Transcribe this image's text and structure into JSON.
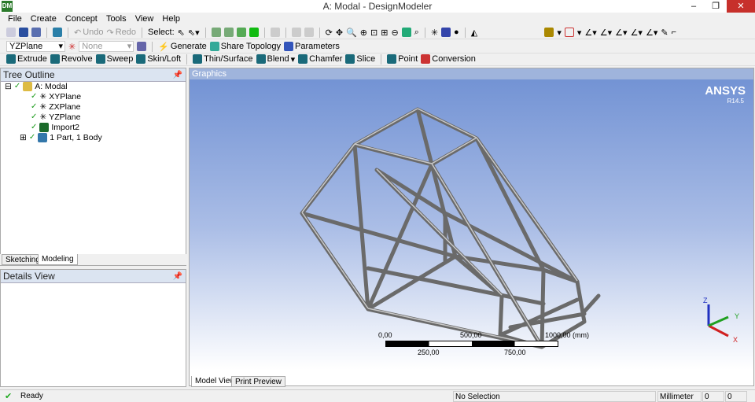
{
  "window": {
    "title": "A: Modal - DesignModeler",
    "app_icon": "DM",
    "minimize": "–",
    "restore": "❐",
    "close": "✕"
  },
  "menu": [
    "File",
    "Create",
    "Concept",
    "Tools",
    "View",
    "Help"
  ],
  "toolbar1": {
    "undo": "Undo",
    "redo": "Redo",
    "select": "Select:"
  },
  "toolbar2": {
    "plane": "YZPlane",
    "sketch": "None",
    "generate": "Generate",
    "share_topology": "Share Topology",
    "parameters": "Parameters"
  },
  "toolbar3": {
    "extrude": "Extrude",
    "revolve": "Revolve",
    "sweep": "Sweep",
    "skin_loft": "Skin/Loft",
    "thin_surface": "Thin/Surface",
    "blend": "Blend",
    "chamfer": "Chamfer",
    "slice": "Slice",
    "point": "Point",
    "conversion": "Conversion"
  },
  "tree": {
    "title": "Tree Outline",
    "items": [
      "A: Modal",
      "XYPlane",
      "ZXPlane",
      "YZPlane",
      "Import2",
      "1 Part, 1 Body"
    ],
    "tabs": [
      "Sketching",
      "Modeling"
    ]
  },
  "details": {
    "title": "Details View"
  },
  "graphics": {
    "title": "Graphics",
    "brand": "ANSYS",
    "version": "R14.5",
    "tabs": [
      "Model View",
      "Print Preview"
    ],
    "scale": {
      "labels_top": [
        "0,00",
        "500,00",
        "1000,00 (mm)"
      ],
      "labels_bottom": [
        "250,00",
        "750,00"
      ]
    },
    "axes": {
      "x": "X",
      "y": "Y",
      "z": "Z"
    },
    "colors": {
      "x": "#d02020",
      "y": "#20a020",
      "z": "#2030c0"
    }
  },
  "status": {
    "state": "Ready",
    "selection": "No Selection",
    "units": "Millimeter",
    "v1": "0",
    "v2": "0"
  }
}
